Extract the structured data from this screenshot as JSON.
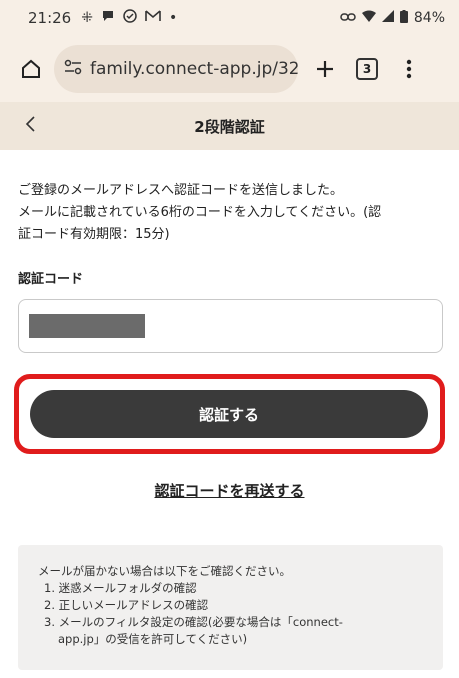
{
  "status_bar": {
    "time": "21:26",
    "battery": "84%"
  },
  "browser": {
    "url": "family.connect-app.jp/32",
    "tab_count": "3"
  },
  "page": {
    "title": "2段階認証",
    "description_line1": "ご登録のメールアドレスへ認証コードを送信しました。",
    "description_line2": "メールに記載されている6桁のコードを入力してください。(認",
    "description_line3": "証コード有効期限：15分)",
    "code_label": "認証コード",
    "submit_label": "認証する",
    "resend_label": "認証コードを再送する"
  },
  "notice": {
    "heading": "メールが届かない場合は以下をご確認ください。",
    "items": [
      "1. 迷惑メールフォルダの確認",
      "2. 正しいメールアドレスの確認",
      "3. メールのフィルタ設定の確認(必要な場合は「connect-",
      "app.jp」の受信を許可してください)"
    ]
  },
  "colors": {
    "highlight": "#e01c1c",
    "button": "#3a3a3a",
    "header_bg": "#efe6da"
  }
}
